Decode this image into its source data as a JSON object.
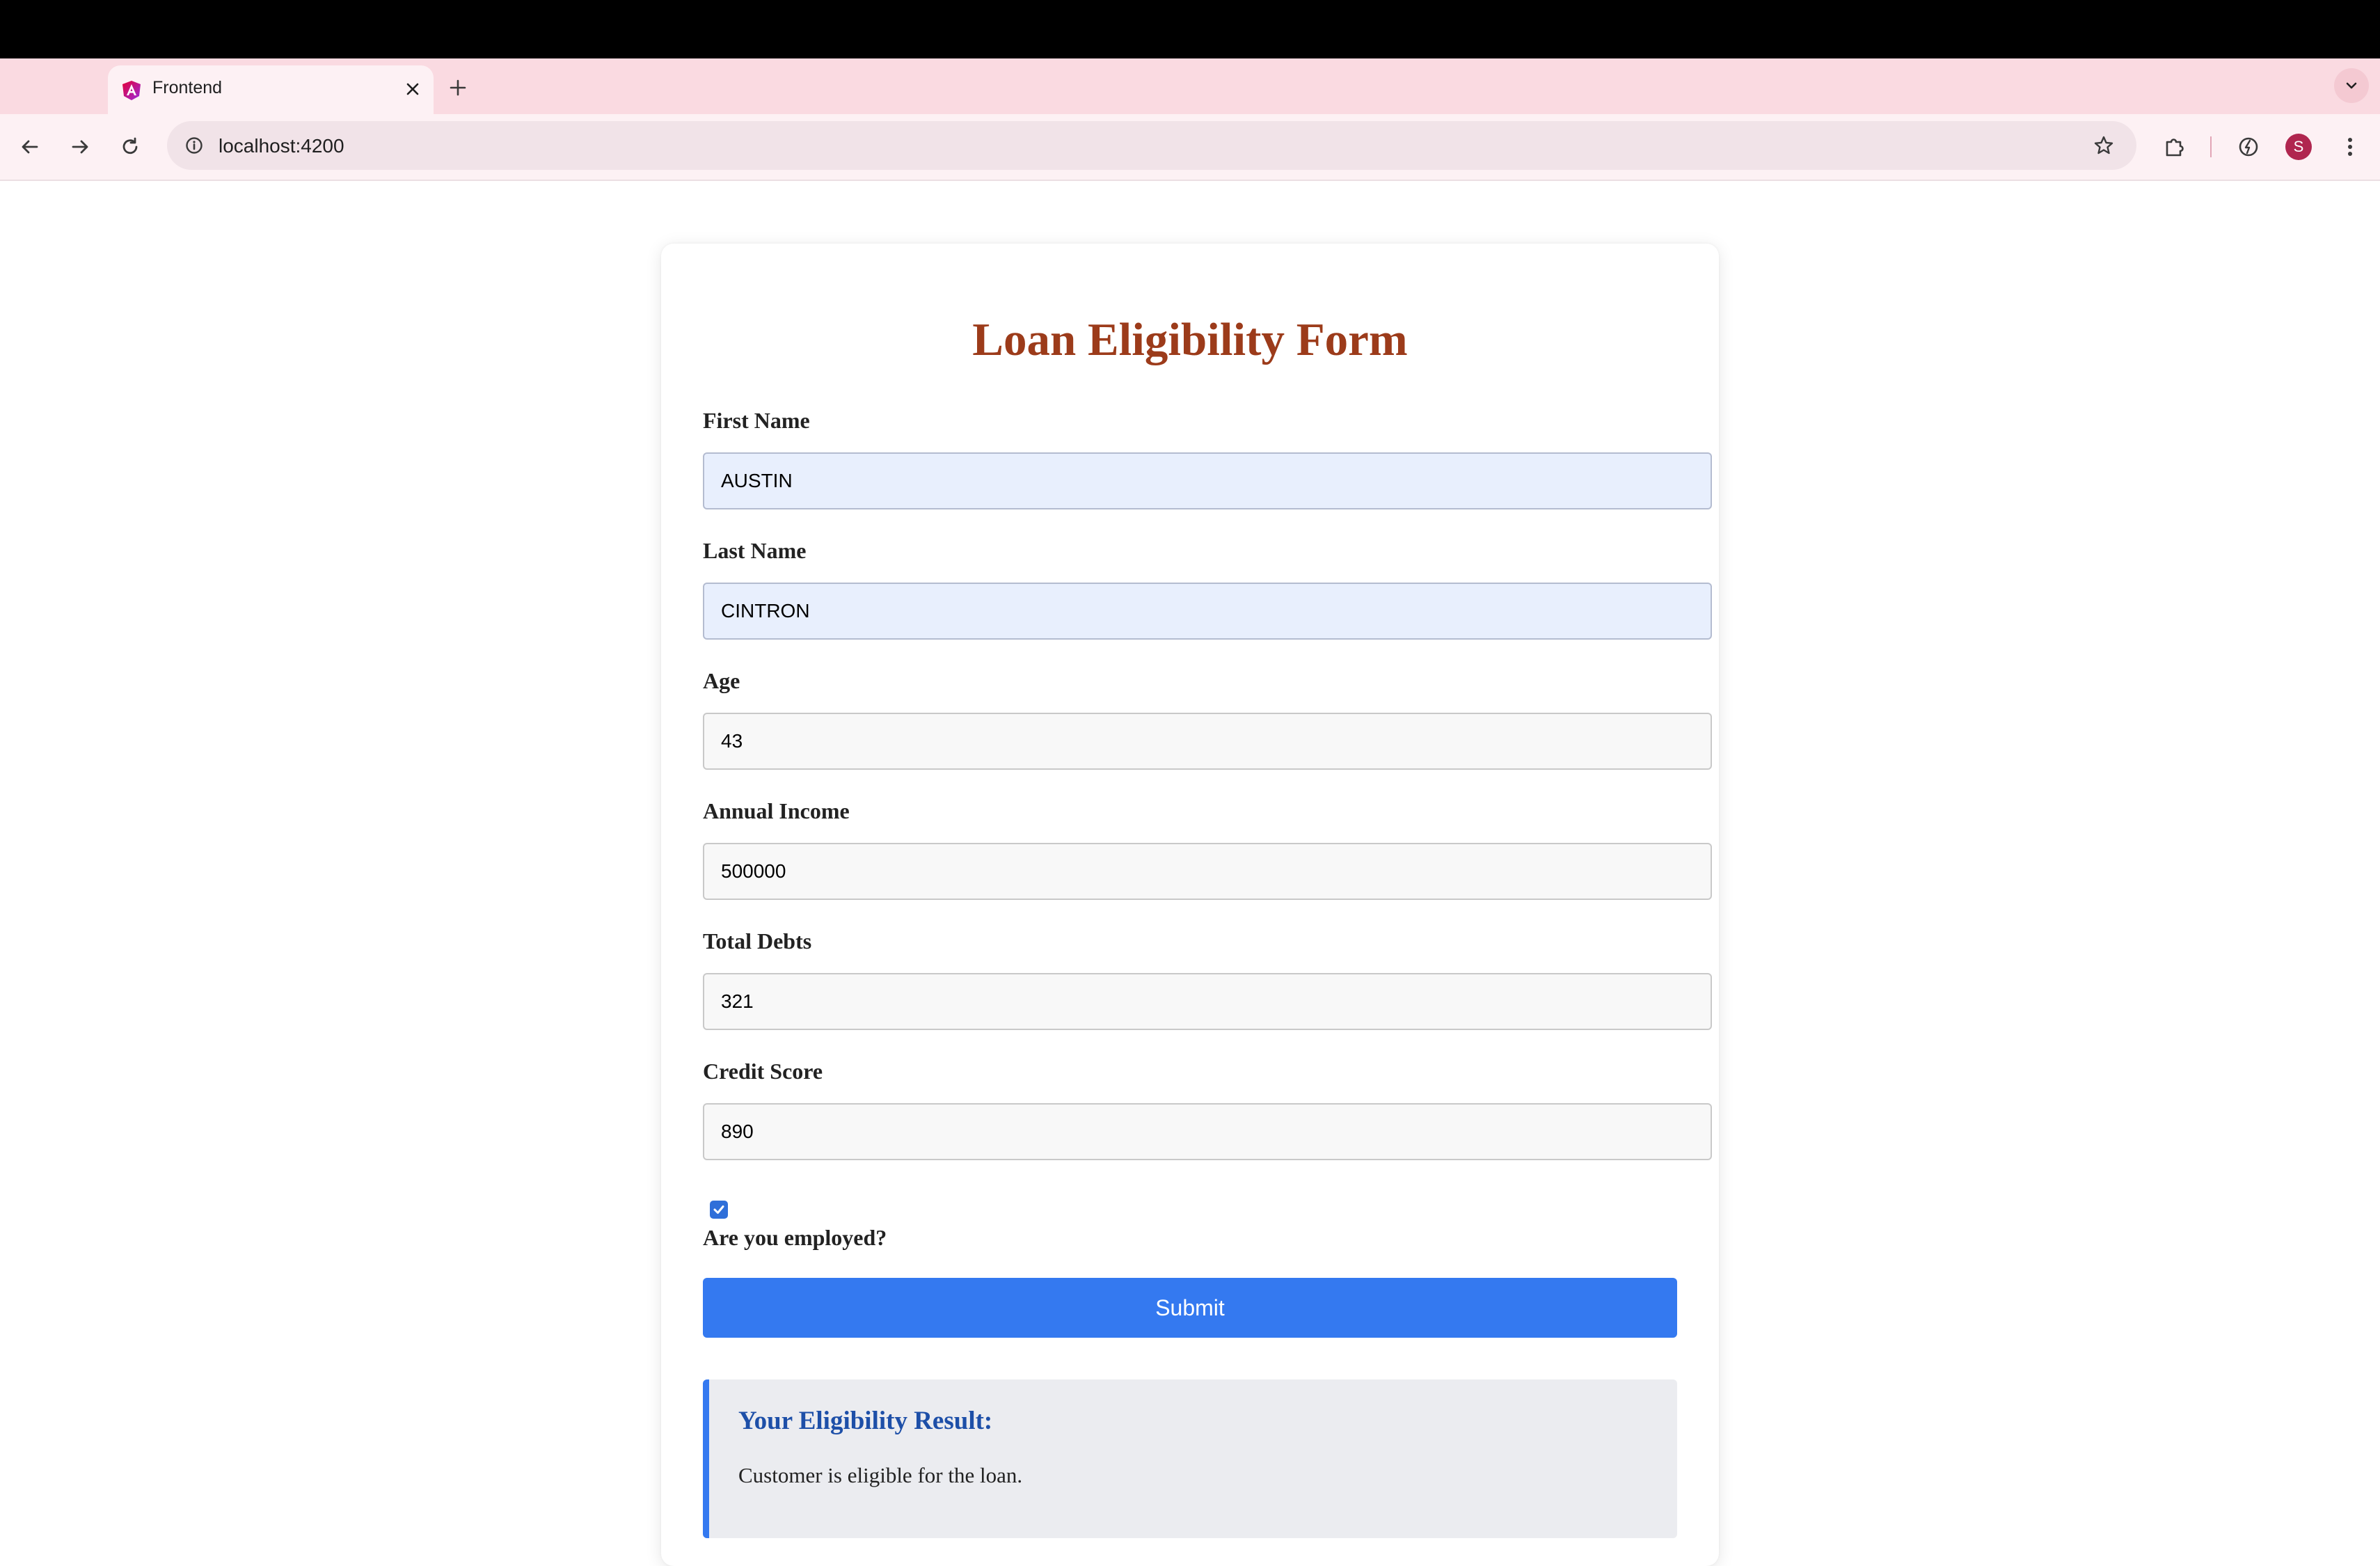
{
  "browser": {
    "tab_title": "Frontend",
    "url": "localhost:4200",
    "profile_initial": "S",
    "accent_color": "#b0264f"
  },
  "form": {
    "title": "Loan Eligibility Form",
    "title_color": "#9c3b1a",
    "fields": [
      {
        "label": "First Name",
        "value": "AUSTIN"
      },
      {
        "label": "Last Name",
        "value": "CINTRON"
      },
      {
        "label": "Age",
        "value": "43"
      },
      {
        "label": "Annual Income",
        "value": "500000"
      },
      {
        "label": "Total Debts",
        "value": "321"
      },
      {
        "label": "Credit Score",
        "value": "890"
      }
    ],
    "employed_checked": true,
    "employed_label": "Are you employed?",
    "submit_label": "Submit",
    "button_color": "#3479f0"
  },
  "result": {
    "title": "Your Eligibility Result:",
    "message": "Customer is eligible for the loan."
  }
}
